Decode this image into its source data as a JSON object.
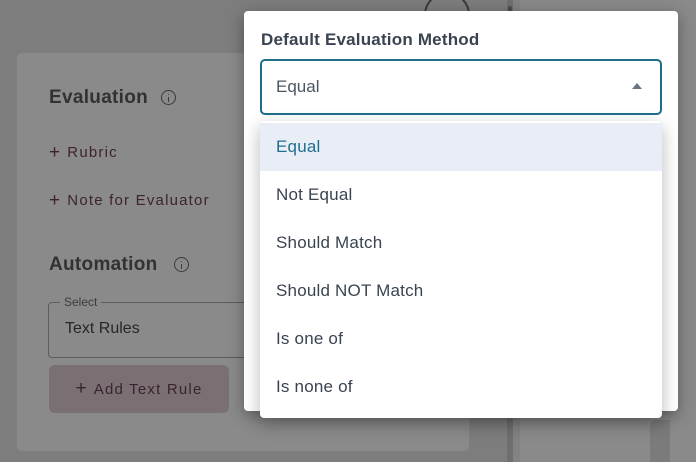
{
  "background": {
    "evaluation": {
      "title": "Evaluation",
      "links": [
        "Rubric",
        "Note for Evaluator"
      ]
    },
    "automation": {
      "title": "Automation",
      "select_legend": "Select",
      "select_value": "Text Rules",
      "add_button_label": "Add Text Rule"
    }
  },
  "popover": {
    "title": "Default Evaluation Method",
    "selected_value": "Equal",
    "options": [
      {
        "label": "Equal",
        "selected": true
      },
      {
        "label": "Not Equal",
        "selected": false
      },
      {
        "label": "Should Match",
        "selected": false
      },
      {
        "label": "Should NOT Match",
        "selected": false
      },
      {
        "label": "Is one of",
        "selected": false
      },
      {
        "label": "Is none of",
        "selected": false
      }
    ]
  },
  "icons": {
    "evaluation_info": "info-icon",
    "automation_info": "info-icon",
    "select_caret": "caret-up-icon",
    "plus": "plus-icon"
  },
  "colors": {
    "accent": "#1f6f8b",
    "selected_option_bg": "#e9eef6",
    "text": "#3a4351",
    "link": "#3f2230"
  }
}
